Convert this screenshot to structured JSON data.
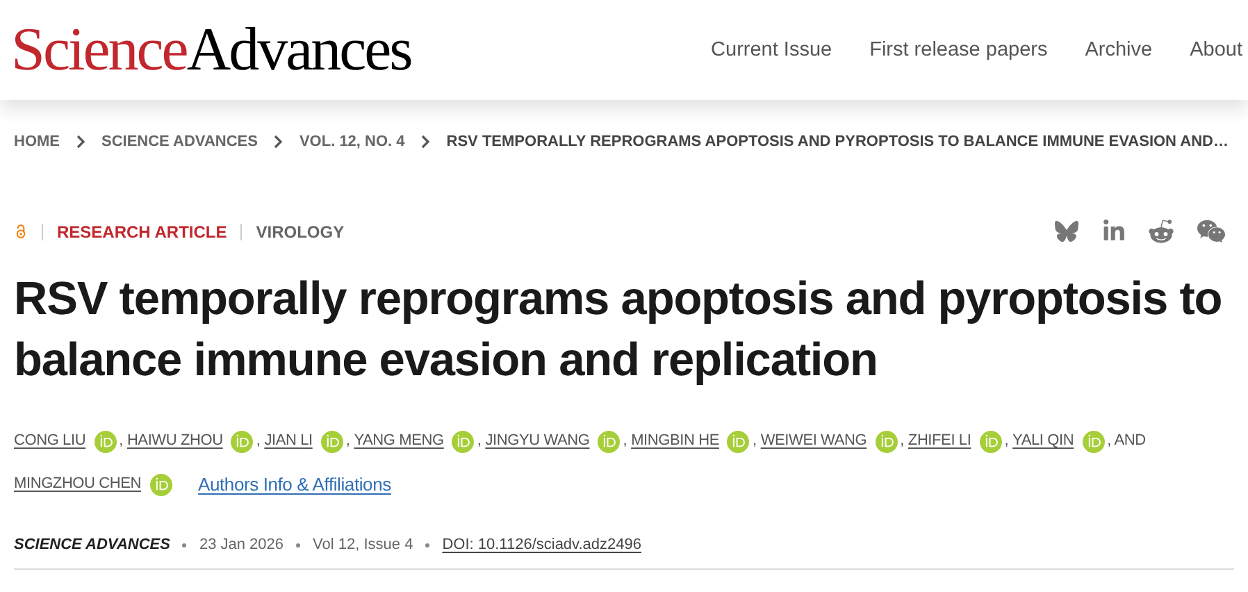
{
  "header": {
    "logo": {
      "first": "Science",
      "second": "Advances"
    },
    "nav": [
      "Current Issue",
      "First release papers",
      "Archive",
      "About"
    ]
  },
  "breadcrumbs": [
    "HOME",
    "SCIENCE ADVANCES",
    "VOL. 12, NO. 4",
    "RSV TEMPORALLY REPROGRAMS APOPTOSIS AND PYROPTOSIS TO BALANCE IMMUNE EVASION AND…"
  ],
  "article": {
    "type": "RESEARCH ARTICLE",
    "subject": "VIROLOGY",
    "title": "RSV temporally reprograms apoptosis and pyroptosis to balance immune evasion and replication",
    "authors": [
      {
        "name": "CONG LIU",
        "separator": ","
      },
      {
        "name": "HAIWU ZHOU",
        "separator": ","
      },
      {
        "name": "JIAN LI",
        "separator": ","
      },
      {
        "name": "YANG MENG",
        "separator": ","
      },
      {
        "name": "JINGYU WANG",
        "separator": ","
      },
      {
        "name": "MINGBIN HE",
        "separator": ","
      },
      {
        "name": "WEIWEI WANG",
        "separator": ","
      },
      {
        "name": "ZHIFEI LI",
        "separator": ","
      },
      {
        "name": "YALI QIN",
        "separator": ", AND"
      },
      {
        "name": "MINGZHOU CHEN"
      }
    ],
    "affiliations_link": "Authors Info & Affiliations",
    "journal": "SCIENCE ADVANCES",
    "date": "23 Jan 2026",
    "issue": "Vol 12, Issue 4",
    "doi": "DOI: 10.1126/sciadv.adz2496"
  }
}
